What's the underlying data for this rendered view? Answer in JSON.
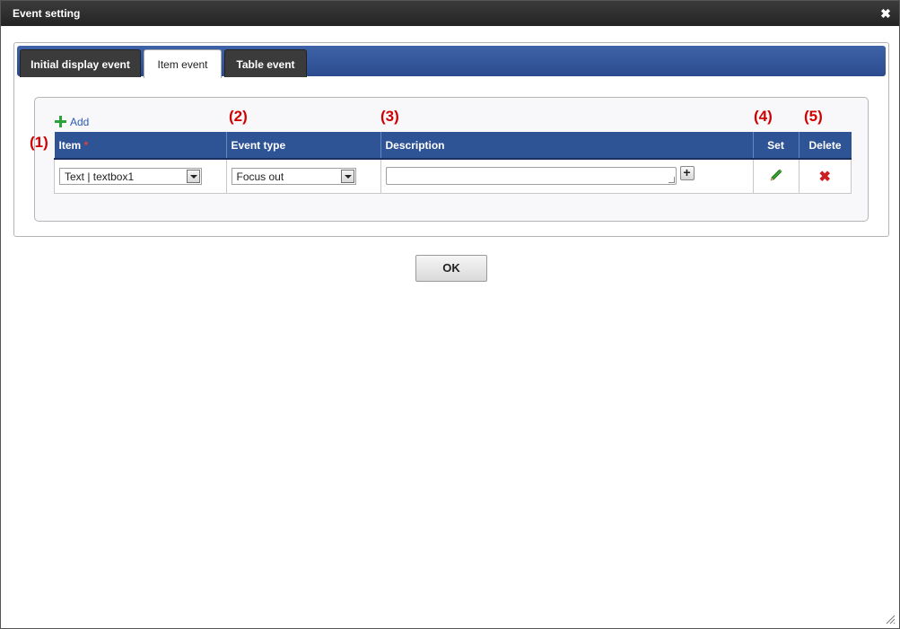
{
  "dialog": {
    "title": "Event setting",
    "close_label": "✖"
  },
  "tabs": [
    {
      "label": "Initial display event",
      "active": false
    },
    {
      "label": "Item event",
      "active": true
    },
    {
      "label": "Table event",
      "active": false
    }
  ],
  "add_label": "Add",
  "annotations": [
    "(1)",
    "(2)",
    "(3)",
    "(4)",
    "(5)"
  ],
  "table": {
    "columns": {
      "item": "Item",
      "item_required": "*",
      "event_type": "Event type",
      "description": "Description",
      "set": "Set",
      "delete": "Delete"
    },
    "rows": [
      {
        "item": "Text | textbox1",
        "event_type": "Focus out",
        "description": ""
      }
    ]
  },
  "ok_label": "OK",
  "colors": {
    "header_bg": "#2f5496",
    "annotation": "#d00000",
    "add_icon": "#29a33a",
    "delete_icon": "#cc1f1f"
  }
}
